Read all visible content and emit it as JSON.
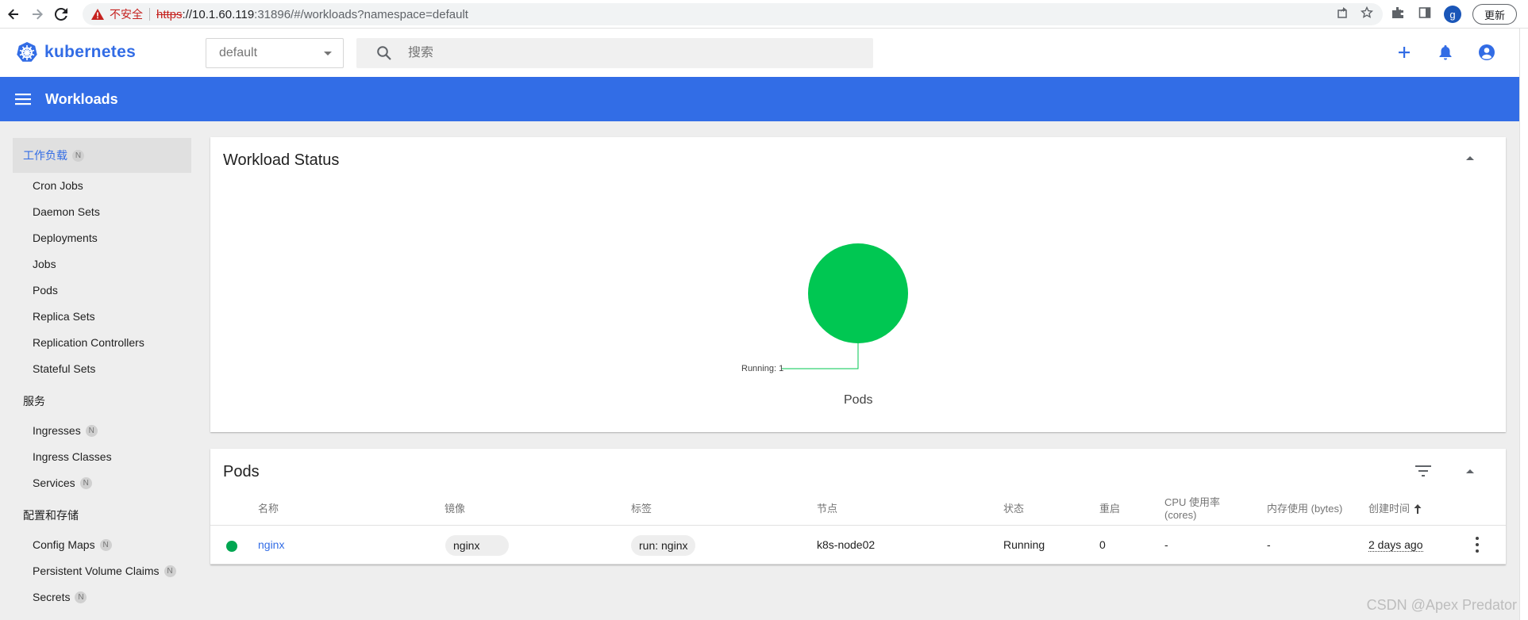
{
  "browser": {
    "insecure_label": "不安全",
    "url_scheme": "https",
    "url_host": "://10.1.60.119",
    "url_rest": ":31896/#/workloads?namespace=default",
    "update_label": "更新",
    "profile_initial": "g"
  },
  "header": {
    "logo_text": "kubernetes",
    "namespace": "default",
    "search_placeholder": "搜索",
    "brand_color": "#326ce5"
  },
  "title_bar": {
    "title": "Workloads"
  },
  "sidebar": {
    "active_section": "工作负载",
    "active_badge": "N",
    "workload_items": [
      "Cron Jobs",
      "Daemon Sets",
      "Deployments",
      "Jobs",
      "Pods",
      "Replica Sets",
      "Replication Controllers",
      "Stateful Sets"
    ],
    "service_group": "服务",
    "service_items": [
      {
        "label": "Ingresses",
        "badge": "N"
      },
      {
        "label": "Ingress Classes",
        "badge": ""
      },
      {
        "label": "Services",
        "badge": "N"
      }
    ],
    "config_group": "配置和存储",
    "config_items": [
      {
        "label": "Config Maps",
        "badge": "N"
      },
      {
        "label": "Persistent Volume Claims",
        "badge": "N"
      },
      {
        "label": "Secrets",
        "badge": "N"
      }
    ]
  },
  "workload_status": {
    "title": "Workload Status",
    "chart_data": {
      "type": "pie",
      "title": "Pods",
      "slices": [
        {
          "label": "Running",
          "value": 1,
          "color": "#00c752"
        }
      ],
      "label_text": "Running: 1"
    }
  },
  "pods": {
    "title": "Pods",
    "columns": [
      "名称",
      "镜像",
      "标签",
      "节点",
      "状态",
      "重启",
      "CPU 使用率",
      "(cores)",
      "内存使用 (bytes)",
      "创建时间"
    ],
    "rows": [
      {
        "name": "nginx",
        "image": "nginx",
        "label": "run: nginx",
        "node": "k8s-node02",
        "status": "Running",
        "restarts": "0",
        "cpu": "-",
        "memory": "-",
        "created": "2 days ago"
      }
    ]
  },
  "watermark": "CSDN @Apex    Predator"
}
